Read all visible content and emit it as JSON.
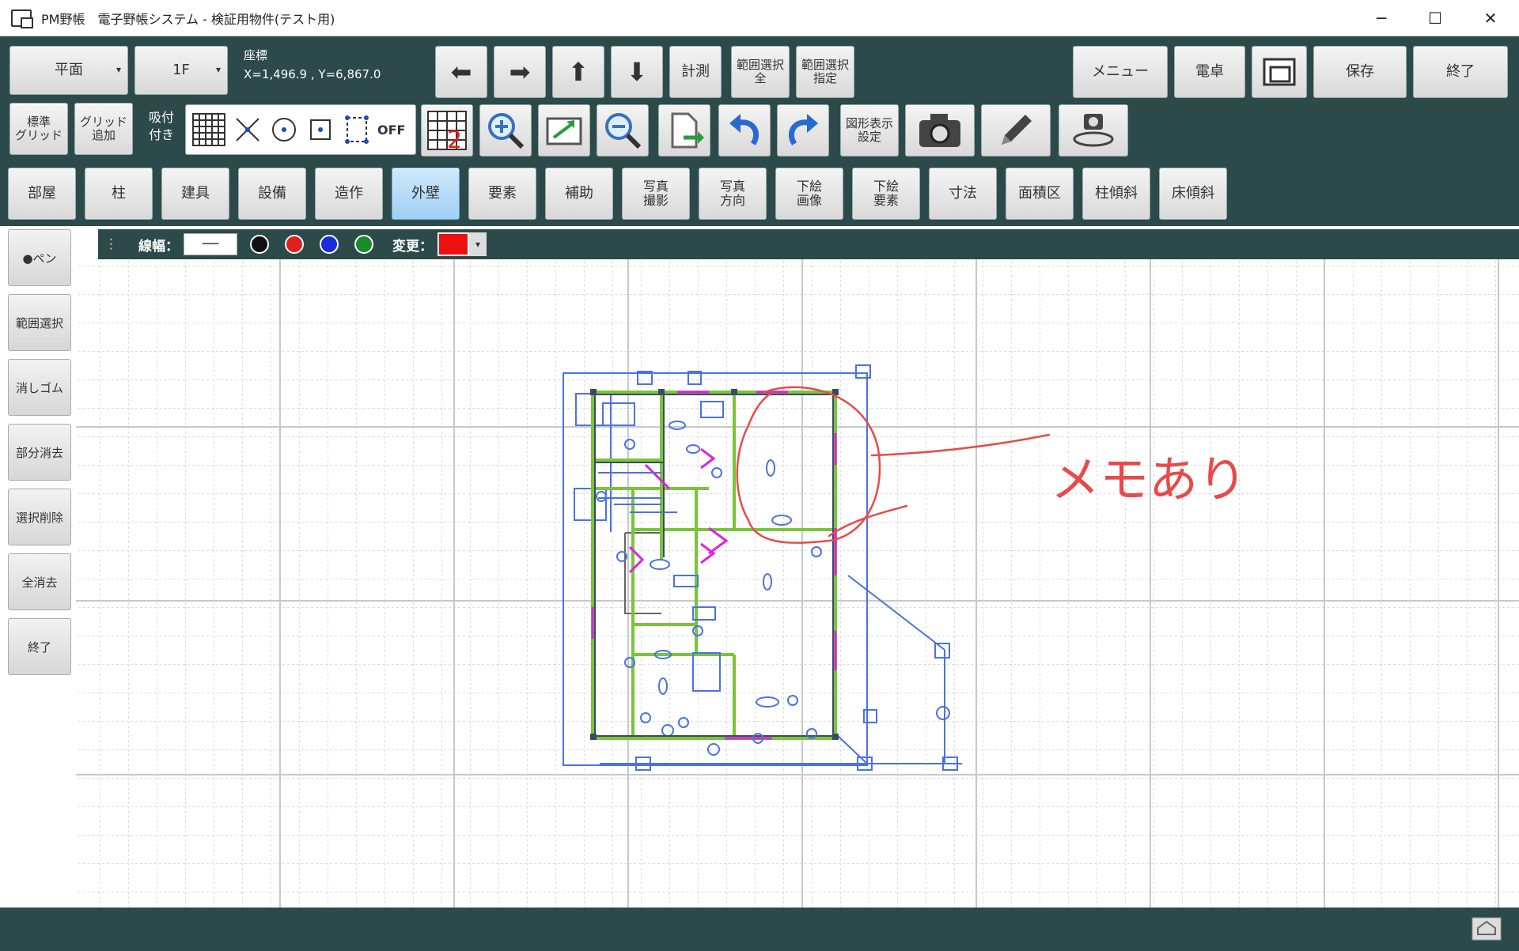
{
  "window": {
    "title": "PM野帳　電子野帳システム - 検証用物件(テスト用)",
    "minimize": "─",
    "maximize": "☐",
    "close": "✕"
  },
  "toolbar": {
    "view_select": "平面",
    "floor_select": "1F",
    "coords_label": "座標",
    "coords_value": "X=1,496.9 , Y=6,867.0",
    "nav_left": "⬅",
    "nav_right": "➡",
    "nav_up": "⬆",
    "nav_down": "⬇",
    "measure": "計測",
    "range_all": "範囲選択\n全",
    "range_spec": "範囲選択\n指定",
    "menu": "メニュー",
    "calc": "電卓",
    "save": "保存",
    "exit": "終了",
    "std_grid": "標準\nグリッド",
    "add_grid": "グリッド\n追加",
    "snap_label": "吸付\n付き",
    "snap_off": "OFF",
    "layer_num": "2",
    "figure_settings": "図形表示\n設定"
  },
  "categories": [
    {
      "label": "部屋",
      "selected": false
    },
    {
      "label": "柱",
      "selected": false
    },
    {
      "label": "建具",
      "selected": false
    },
    {
      "label": "設備",
      "selected": false
    },
    {
      "label": "造作",
      "selected": false
    },
    {
      "label": "外壁",
      "selected": true
    },
    {
      "label": "要素",
      "selected": false
    },
    {
      "label": "補助",
      "selected": false
    },
    {
      "label": "写真\n撮影",
      "selected": false
    },
    {
      "label": "写真\n方向",
      "selected": false
    },
    {
      "label": "下絵\n画像",
      "selected": false
    },
    {
      "label": "下絵\n要素",
      "selected": false
    },
    {
      "label": "寸法",
      "selected": false
    },
    {
      "label": "面積区",
      "selected": false
    },
    {
      "label": "柱傾斜",
      "selected": false
    },
    {
      "label": "床傾斜",
      "selected": false
    }
  ],
  "sidebar": [
    {
      "label": "●ペン"
    },
    {
      "label": "範囲選択"
    },
    {
      "label": "消しゴム"
    },
    {
      "label": "部分消去"
    },
    {
      "label": "選択削除"
    },
    {
      "label": "全消去"
    },
    {
      "label": "終了"
    }
  ],
  "penbar": {
    "line_width_label": "線幅：",
    "line_width_value": "──",
    "change_label": "変更：",
    "colors": [
      "#111111",
      "#e0201e",
      "#1a2be0",
      "#1a8a2a"
    ],
    "current_color": "#ee1111"
  },
  "memo": {
    "text": "メモあり"
  }
}
